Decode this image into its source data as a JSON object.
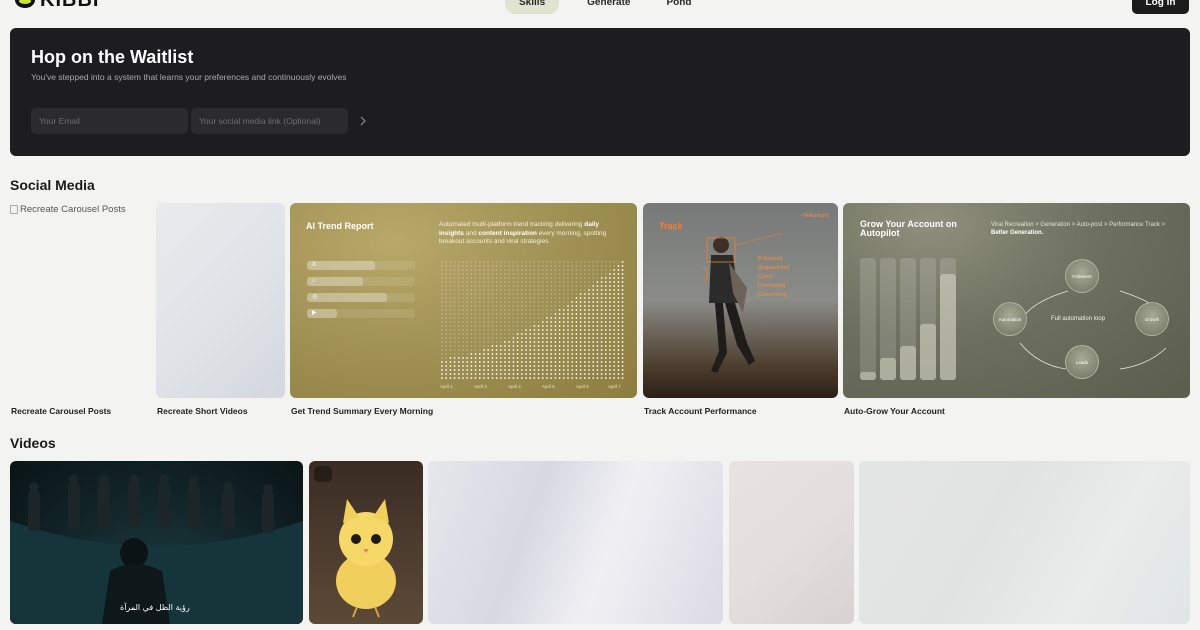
{
  "nav": {
    "logo_text": "KIBBI",
    "tabs": [
      {
        "label": "Skills",
        "active": true
      },
      {
        "label": "Generate",
        "active": false
      },
      {
        "label": "Pond",
        "active": false
      }
    ],
    "login_label": "Log in"
  },
  "hero": {
    "title": "Hop on the Waitlist",
    "subtitle": "You've stepped into a system that learns your preferences and continuously evolves",
    "email_placeholder": "Your Email",
    "social_placeholder": "Your social media link (Optional)",
    "submit_icon": "chevron-right-icon"
  },
  "social_media": {
    "title": "Social Media",
    "cards": [
      {
        "label": "Recreate Carousel Posts",
        "broken_image_alt": "Recreate Carousel Posts"
      },
      {
        "label": "Recreate Short Videos"
      },
      {
        "label": "Get Trend Summary Every Morning",
        "preview": {
          "title": "AI Trend Report",
          "desc_a": "Automated multi-platform trend tracking delivering ",
          "desc_b": "daily insights",
          "desc_c": " and ",
          "desc_d": "content inspiration",
          "desc_e": " every morning, spotting breakout accounts and viral strategies",
          "platforms": [
            "X",
            "♪",
            "◎",
            "▶"
          ],
          "axis": [
            "April 2",
            "April 3",
            "April 4",
            "April 5",
            "April 6",
            "April 7"
          ]
        }
      },
      {
        "label": "Track Account Performance",
        "preview": {
          "title": "Track",
          "tag": "• [Influencer]",
          "metrics": [
            "[Followers]",
            "[Engagement]",
            "[Likes]",
            "[Comments]",
            "[Conversion]"
          ]
        }
      },
      {
        "label": "Auto-Grow Your Account",
        "preview": {
          "title": "Grow Your Account on Autopilot",
          "flow": "Viral Recreation > Generation > Auto-post > Performance Track > ",
          "flow_bold": "Better Generation.",
          "nodes": [
            "Followers",
            "Growth",
            "Leads",
            "Automation"
          ],
          "center": "Full automation loop"
        }
      }
    ]
  },
  "videos": {
    "title": "Videos",
    "caption": "رؤية الظل في المرآة"
  }
}
